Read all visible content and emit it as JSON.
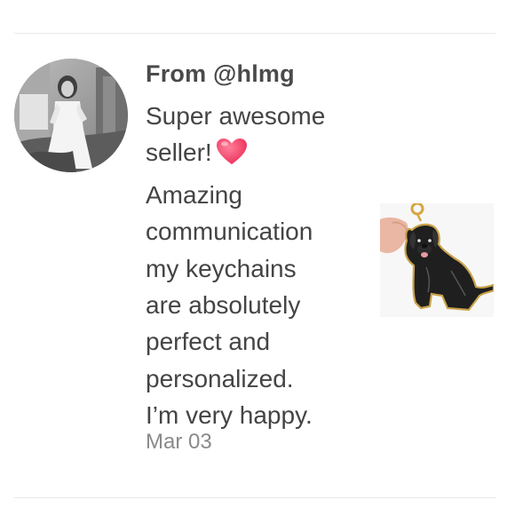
{
  "review": {
    "reviewer": "From @hlmg",
    "text_lines": [
      "Super awesome",
      "seller!",
      "Amazing",
      "communication",
      "my keychains",
      "are absolutely",
      "perfect and",
      "personalized.",
      "I’m very happy."
    ],
    "date": "Mar 03",
    "avatar_icon": "user-avatar-photo",
    "emoji_icon": "heart-icon",
    "product_icon": "black-labrador-keychain-photo",
    "colors": {
      "heart": "#f2456a",
      "divider": "#e8e8e8",
      "text": "#444444",
      "date": "#8a8a8a"
    }
  }
}
